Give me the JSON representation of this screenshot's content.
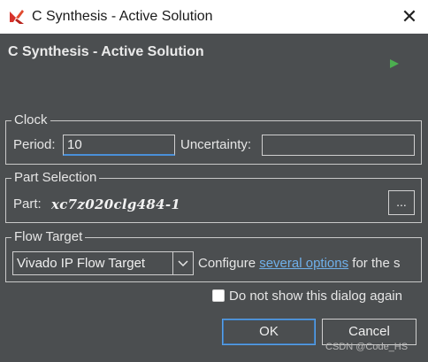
{
  "window": {
    "title": "C Synthesis - Active Solution",
    "close_glyph": "✕"
  },
  "heading": "C Synthesis - Active Solution",
  "clock": {
    "legend": "Clock",
    "period_label": "Period:",
    "period_value": "10",
    "uncertainty_label": "Uncertainty:",
    "uncertainty_value": ""
  },
  "part_selection": {
    "legend": "Part Selection",
    "part_label": "Part:",
    "part_value": "xc7z020clg484-1",
    "browse_label": "..."
  },
  "flow_target": {
    "legend": "Flow Target",
    "selected": "Vivado IP Flow Target",
    "configure_prefix": "Configure",
    "configure_link": "several options",
    "configure_suffix": "for the s"
  },
  "dont_show_label": "Do not show this dialog again",
  "buttons": {
    "ok": "OK",
    "cancel": "Cancel"
  },
  "watermark": "CSDN @Code_HS",
  "colors": {
    "background": "#4b4e50",
    "accent": "#4a90d9",
    "link": "#6fb0ea",
    "run_icon": "#4caf50"
  },
  "icons": {
    "app": "xilinx-logo-icon",
    "close": "close-icon",
    "run": "play-icon",
    "dropdown": "chevron-down-icon"
  }
}
